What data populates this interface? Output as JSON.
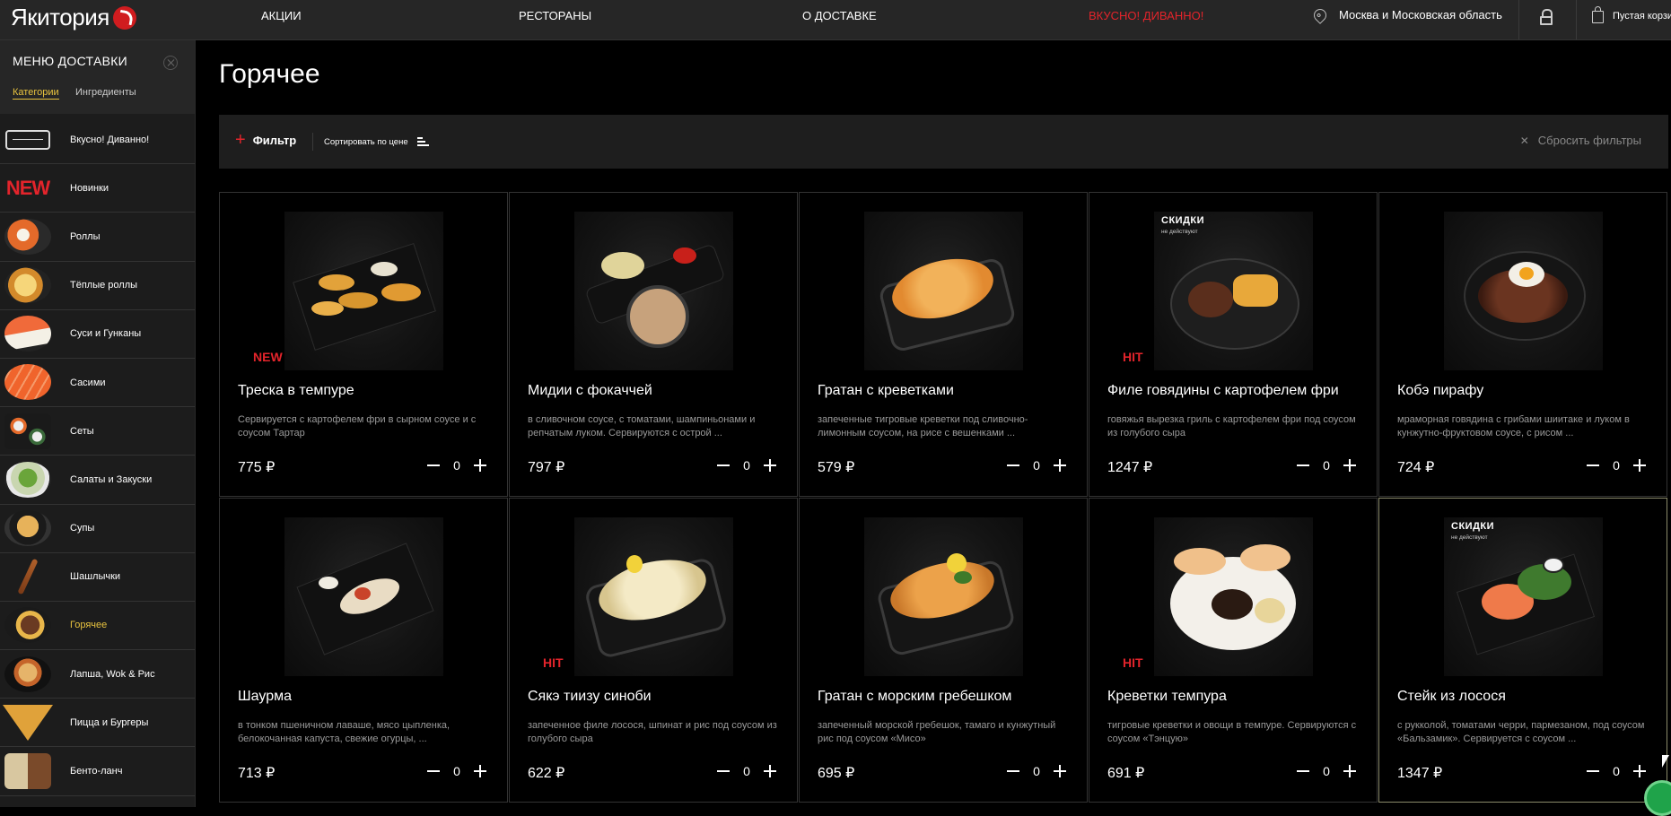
{
  "header": {
    "logo_text": "Якитория",
    "nav": [
      "АКЦИИ",
      "РЕСТОРАНЫ",
      "О ДОСТАВКЕ",
      "ВКУСНО! ДИВАННО!"
    ],
    "location": "Москва и Московская область",
    "cart_label": "Пустая корзина"
  },
  "sidebar": {
    "title": "МЕНЮ ДОСТАВКИ",
    "tabs": [
      "Категории",
      "Ингредиенты"
    ],
    "new_badge": "NEW",
    "items": [
      {
        "label": "Вкусно! Диванно!",
        "icon": "sofa-icon"
      },
      {
        "label": "Новинки",
        "icon": "new-icon"
      },
      {
        "label": "Роллы",
        "icon": "rolls-icon"
      },
      {
        "label": "Тёплые роллы",
        "icon": "warm-rolls-icon"
      },
      {
        "label": "Суси и Гунканы",
        "icon": "sushi-icon"
      },
      {
        "label": "Сасими",
        "icon": "sashimi-icon"
      },
      {
        "label": "Сеты",
        "icon": "sets-icon"
      },
      {
        "label": "Салаты и Закуски",
        "icon": "salad-icon"
      },
      {
        "label": "Супы",
        "icon": "soup-icon"
      },
      {
        "label": "Шашлычки",
        "icon": "skewer-icon"
      },
      {
        "label": "Горячее",
        "icon": "hot-dish-icon",
        "active": true
      },
      {
        "label": "Лапша, Wok & Рис",
        "icon": "noodles-icon"
      },
      {
        "label": "Пицца и Бургеры",
        "icon": "pizza-icon"
      },
      {
        "label": "Бенто-ланч",
        "icon": "bento-icon"
      }
    ]
  },
  "main": {
    "title": "Горячее",
    "filter_label": "Фильтр",
    "sort_label": "Сортировать по цене",
    "reset_label": "Сбросить фильтры",
    "currency": "₽",
    "promo_title": "СКИДКИ",
    "promo_sub": "не действуют",
    "products": [
      {
        "title": "Треска в темпуре",
        "desc": "Сервируется с картофелем фри в сырном соусе и с соусом Тартар",
        "price": "775 ₽",
        "qty": "0",
        "badge": "NEW"
      },
      {
        "title": "Мидии с фокаччей",
        "desc": "в сливочном соусе, с томатами, шампиньонами и репчатым луком. Сервируются с острой ...",
        "price": "797 ₽",
        "qty": "0",
        "badge": ""
      },
      {
        "title": "Гратан с креветками",
        "desc": "запеченные тигровые креветки под сливочно-лимонным соусом, на рисе с вешенками ...",
        "price": "579 ₽",
        "qty": "0",
        "badge": ""
      },
      {
        "title": "Филе говядины с картофелем фри",
        "desc": "говяжья вырезка гриль с картофелем фри под соусом из голубого сыра",
        "price": "1247 ₽",
        "qty": "0",
        "badge": "HIT",
        "promo": true
      },
      {
        "title": "Кобэ пирафу",
        "desc": "мраморная говядина с грибами шиитаке и луком в кунжутно-фруктовом соусе, с рисом ...",
        "price": "724 ₽",
        "qty": "0",
        "badge": ""
      },
      {
        "title": "Шаурма",
        "desc": "в тонком пшеничном лаваше, мясо цыпленка, белокочанная капуста, свежие огурцы, ...",
        "price": "713 ₽",
        "qty": "0",
        "badge": ""
      },
      {
        "title": "Сякэ тиизу синоби",
        "desc": "запеченное филе лосося, шпинат и рис под соусом из голубого сыра",
        "price": "622 ₽",
        "qty": "0",
        "badge": "HIT"
      },
      {
        "title": "Гратан с морским гребешком",
        "desc": "запеченный морской гребешок, тамаго и кунжутный рис под соусом «Мисо»",
        "price": "695 ₽",
        "qty": "0",
        "badge": ""
      },
      {
        "title": "Креветки темпура",
        "desc": "тигровые креветки и овощи в темпуре. Сервируются с соусом «Тэнцую»",
        "price": "691 ₽",
        "qty": "0",
        "badge": "HIT"
      },
      {
        "title": "Стейк из лосося",
        "desc": "с рукколой, томатами черри, пармезаном, под соусом «Бальзамик». Сервируется с соусом ...",
        "price": "1347 ₽",
        "qty": "0",
        "badge": "",
        "promo": true
      }
    ]
  },
  "colors": {
    "accent_red": "#e3242b",
    "active_yellow": "#e8c33f",
    "background": "#000000",
    "panel": "#1e1e1e"
  }
}
